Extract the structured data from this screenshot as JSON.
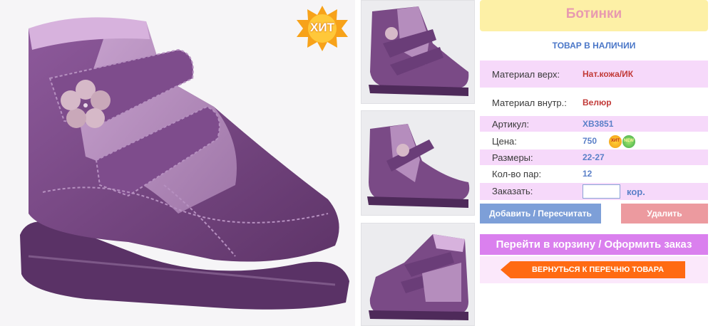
{
  "images": {
    "main": "purple-velcro-boot-main-photo",
    "thumbnails": [
      "boot-thumb-front",
      "boot-thumb-side",
      "boot-thumb-angle"
    ]
  },
  "badge": {
    "hit": "ХИТ",
    "mini_hit": "ХИТ",
    "mini_new": "NEW"
  },
  "product": {
    "title": "Ботинки",
    "availability": "ТОВАР В НАЛИЧИИ",
    "specs": {
      "upper_label": "Материал верх:",
      "upper_value": "Нат.кожа/ИК",
      "inner_label": "Материал внутр.:",
      "inner_value": "Велюр",
      "article_label": "Артикул:",
      "article_value": "XB3851",
      "price_label": "Цена:",
      "price_value": "750",
      "sizes_label": "Размеры:",
      "sizes_value": "22-27",
      "pairs_label": "Кол-во пар:",
      "pairs_value": "12",
      "order_label": "Заказать:",
      "order_value": "",
      "order_unit": "кор."
    }
  },
  "actions": {
    "add": "Добавить / Пересчитать",
    "delete": "Удалить",
    "cart": "Перейти в корзину / Оформить заказ",
    "back": "ВЕРНУТЬСЯ К ПЕРЕЧНЮ ТОВАРА"
  },
  "colors": {
    "title_bg": "#fdf0a6",
    "title_text": "#e89ab0",
    "row_pink": "#f6d9fa",
    "value_blue": "#5b80c8",
    "value_red": "#c23a38",
    "btn_add": "#7d9fd8",
    "btn_delete": "#ec9a9f",
    "btn_cart": "#da80ee",
    "btn_back": "#ff6a12",
    "boot_purple": "#7a4a86"
  }
}
